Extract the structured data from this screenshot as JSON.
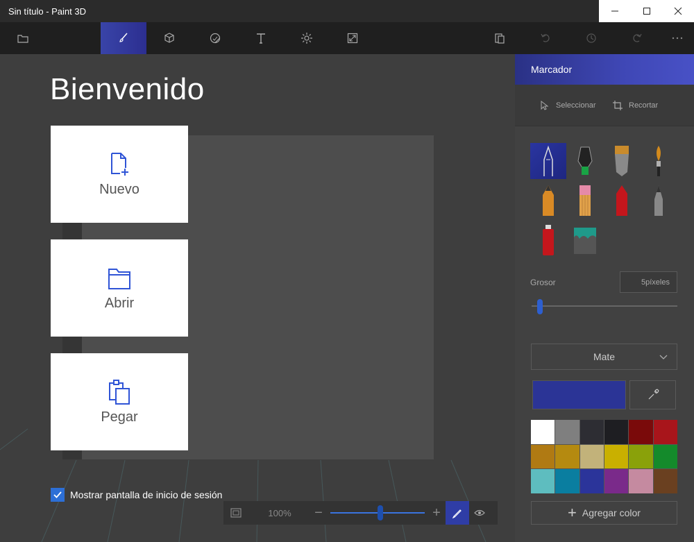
{
  "window": {
    "title": "Sin título - Paint 3D",
    "minimize": "—",
    "maximize": "☐",
    "close": "✕"
  },
  "toolbar": {
    "items": [
      {
        "name": "menu-icon"
      },
      {
        "name": "brush-icon",
        "active": true
      },
      {
        "name": "3d-cube-icon"
      },
      {
        "name": "stickers-icon"
      },
      {
        "name": "text-icon"
      },
      {
        "name": "effects-icon"
      },
      {
        "name": "canvas-icon"
      },
      {
        "name": "paste-icon"
      },
      {
        "name": "undo-icon"
      },
      {
        "name": "history-icon"
      },
      {
        "name": "redo-icon"
      },
      {
        "name": "more-icon"
      }
    ]
  },
  "welcome": {
    "title": "Bienvenido",
    "cards": [
      {
        "label": "Nuevo",
        "icon": "new-file-icon"
      },
      {
        "label": "Abrir",
        "icon": "folder-icon"
      },
      {
        "label": "Pegar",
        "icon": "paste-icon"
      }
    ],
    "startup_checkbox": {
      "label": "Mostrar pantalla de inicio de sesión",
      "checked": true
    }
  },
  "zoom": {
    "percent": "100%",
    "level": 0.53
  },
  "panel": {
    "title": "Marcador",
    "tools": {
      "select": "Seleccionar",
      "crop": "Recortar"
    },
    "brushes": [
      {
        "name": "marker",
        "active": true
      },
      {
        "name": "calligraphy-pen"
      },
      {
        "name": "oil-brush"
      },
      {
        "name": "watercolor"
      },
      {
        "name": "pixel-pen"
      },
      {
        "name": "pencil"
      },
      {
        "name": "eraser"
      },
      {
        "name": "crayon"
      },
      {
        "name": "spray-can"
      },
      {
        "name": "fill"
      }
    ],
    "grosor_label": "Grosor",
    "grosor_value": "5píxeles",
    "grosor_level": 0.04,
    "finish": "Mate",
    "current_color": "#2b3496",
    "palette": [
      "#ffffff",
      "#7f7f7f",
      "#2d2d33",
      "#1e1e22",
      "#7a0a0a",
      "#a8151b",
      "#b07a13",
      "#b58a10",
      "#c2b27a",
      "#c9b000",
      "#8aa10a",
      "#148a2b",
      "#5ebdbf",
      "#0a7ea0",
      "#2b349a",
      "#7a2a8a",
      "#c58aa0",
      "#6a4020"
    ],
    "add_color": "Agregar color"
  }
}
